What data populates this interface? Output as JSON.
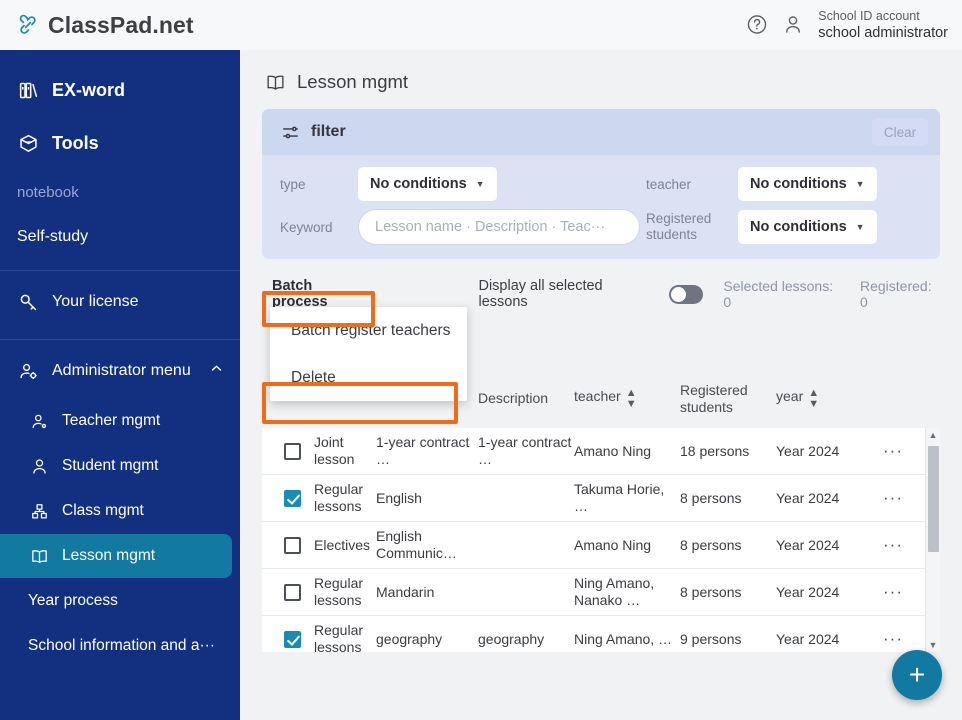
{
  "colors": {
    "sidebar_bg": "#12307f",
    "accent_teal": "#1279a0",
    "annotation_orange": "#ef6c1a",
    "filter_bg": "#dbe2f4",
    "checkbox_checked": "#1a8bb3"
  },
  "topbar": {
    "brand": "ClassPad.net",
    "logo_icon": "chain-link-icon",
    "help_icon": "help-circle-icon",
    "account_icon": "person-icon",
    "account_sub": "School ID account",
    "account_name": "school administrator"
  },
  "sidebar": {
    "top_items": [
      {
        "label": "EX-word",
        "icon": "books-icon",
        "style": "big"
      },
      {
        "label": "Tools",
        "icon": "toolbox-icon",
        "style": "big"
      },
      {
        "label": "notebook",
        "icon": "",
        "style": "muted"
      },
      {
        "label": "Self-study",
        "icon": "",
        "style": "plain"
      }
    ],
    "license": {
      "label": "Your license",
      "icon": "key-icon"
    },
    "admin": {
      "label": "Administrator menu",
      "icon": "admin-person-icon",
      "chevron": "chevron-up-icon",
      "expanded": true
    },
    "admin_items": [
      {
        "label": "Teacher mgmt",
        "icon": "teacher-icon",
        "active": false
      },
      {
        "label": "Student mgmt",
        "icon": "student-icon",
        "active": false
      },
      {
        "label": "Class mgmt",
        "icon": "class-icon",
        "active": false
      },
      {
        "label": "Lesson mgmt",
        "icon": "book-open-icon",
        "active": true
      },
      {
        "label": "Year process",
        "icon": "",
        "active": false
      },
      {
        "label": "School information and a···",
        "icon": "",
        "active": false
      }
    ]
  },
  "page": {
    "title": "Lesson mgmt",
    "title_icon": "book-open-icon"
  },
  "filter": {
    "heading": "filter",
    "heading_icon": "sliders-icon",
    "clear_label": "Clear",
    "type_label": "type",
    "type_value": "No conditions",
    "keyword_label": "Keyword",
    "keyword_value": "",
    "keyword_placeholder": "Lesson name · Description · Teac···",
    "teacher_label": "teacher",
    "teacher_value": "No conditions",
    "registered_label": "Registered students",
    "registered_value": "No conditions"
  },
  "toolbar": {
    "batch_label": "Batch process",
    "toggle_label": "Display all selected lessons",
    "toggle_on": false,
    "selected_counter": "Selected lessons: 0",
    "registered_counter": "Registered: 0"
  },
  "menu": {
    "items": [
      {
        "label": "Batch register teachers"
      },
      {
        "label": "Delete"
      }
    ]
  },
  "table": {
    "headers": [
      {
        "label": "",
        "sortable": false
      },
      {
        "label": "",
        "sortable": false
      },
      {
        "label": "",
        "sortable": false
      },
      {
        "label": "Description",
        "sortable": true
      },
      {
        "label": "teacher",
        "sortable": true
      },
      {
        "label": "Registered students",
        "sortable": true
      },
      {
        "label": "year",
        "sortable": true
      },
      {
        "label": "",
        "sortable": false
      }
    ],
    "sort_icon": "sort-updown-icon",
    "more_icon": "ellipsis-icon",
    "rows": [
      {
        "checked": false,
        "type": "Joint lesson",
        "name": "1-year contract …",
        "description": "1-year contract …",
        "teacher": "Amano Ning",
        "registered": "18 persons",
        "year": "Year 2024",
        "more": "···"
      },
      {
        "checked": true,
        "type": "Regular lessons",
        "name": "English",
        "description": "",
        "teacher": "Takuma Horie, …",
        "registered": "8 persons",
        "year": "Year 2024",
        "more": "···"
      },
      {
        "checked": false,
        "type": "Electives",
        "name": "English Communic…",
        "description": "",
        "teacher": "Amano Ning",
        "registered": "8 persons",
        "year": "Year 2024",
        "more": "···"
      },
      {
        "checked": false,
        "type": "Regular lessons",
        "name": "Mandarin",
        "description": "",
        "teacher": "Ning Amano, Nanako …",
        "registered": "8 persons",
        "year": "Year 2024",
        "more": "···"
      },
      {
        "checked": true,
        "type": "Regular lessons",
        "name": "geography",
        "description": "geography",
        "teacher": "Ning Amano, …",
        "registered": "9 persons",
        "year": "Year 2024",
        "more": "···"
      }
    ]
  },
  "scrollbar": {
    "up_icon": "triangle-up-icon",
    "down_icon": "triangle-down-icon"
  },
  "fab": {
    "label": "+",
    "icon": "plus-icon"
  }
}
